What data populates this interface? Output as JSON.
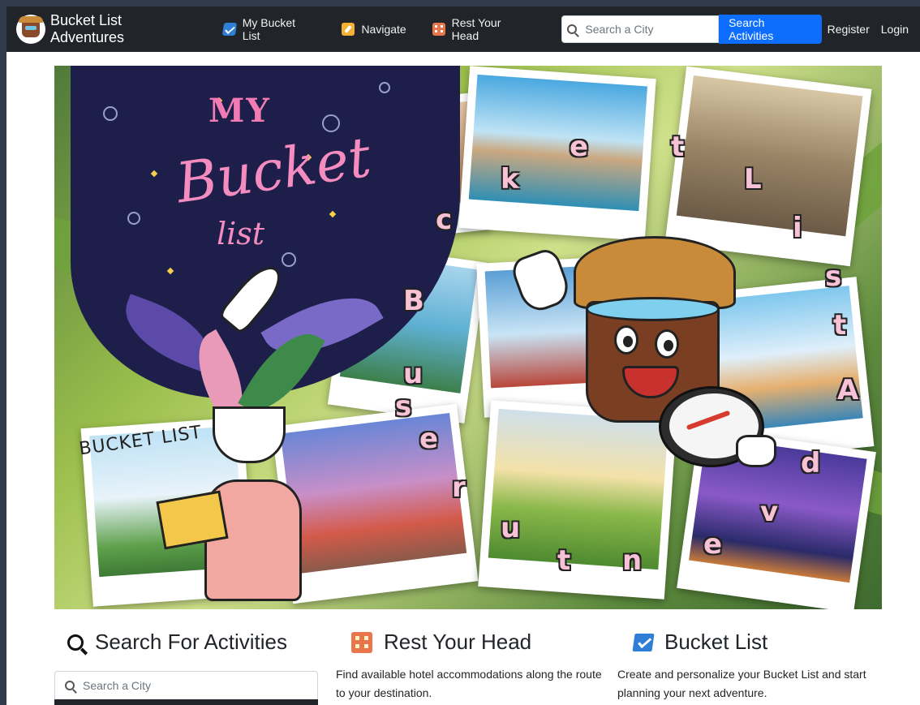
{
  "navbar": {
    "brand": "Bucket List Adventures",
    "links": [
      {
        "label": "My Bucket List",
        "icon": "bucket-check-icon"
      },
      {
        "label": "Navigate",
        "icon": "compass-icon"
      },
      {
        "label": "Rest Your Head",
        "icon": "hotel-icon"
      }
    ],
    "search_placeholder": "Search a City",
    "search_button": "Search Activities",
    "register": "Register",
    "login": "Login"
  },
  "hero": {
    "title_my": "MY",
    "title_bucket": "Bucket",
    "title_list": "list",
    "banner_letters": [
      "B",
      "u",
      "c",
      "k",
      "e",
      "t",
      "L",
      "i",
      "s",
      "t",
      "A",
      "d",
      "v",
      "e",
      "n",
      "t",
      "u",
      "r",
      "e",
      "s"
    ]
  },
  "sections": [
    {
      "title": "Search For Activities",
      "icon": "search-icon"
    },
    {
      "title": "Rest Your Head",
      "icon": "hotel-icon",
      "text": "Find available hotel accommodations along the route to your destination."
    },
    {
      "title": "Bucket List",
      "icon": "bucket-check-icon",
      "text": "Create and personalize your Bucket List and start planning your next adventure."
    }
  ],
  "bottom_search": {
    "placeholder": "Search a City"
  },
  "colors": {
    "navbar_bg": "#212529",
    "primary": "#0d6efd",
    "page_bg": "#ffffff",
    "border": "#2f3a4a"
  }
}
